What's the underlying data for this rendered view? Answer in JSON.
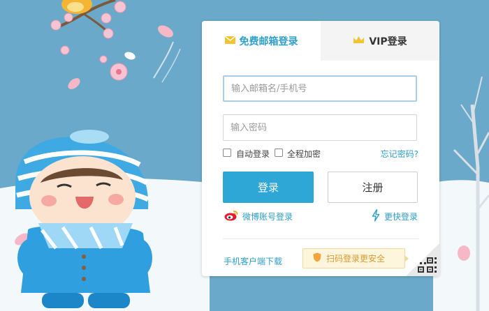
{
  "tabs": {
    "mail_label": "免费邮箱登录",
    "vip_label": "VIP登录",
    "mail_icon": "envelope-icon",
    "vip_icon": "crown-icon"
  },
  "form": {
    "email_placeholder": "输入邮箱名/手机号",
    "email_value": "",
    "password_placeholder": "输入密码",
    "password_value": "",
    "auto_login_label": "自动登录",
    "auto_login_checked": false,
    "full_encrypt_label": "全程加密",
    "full_encrypt_checked": false,
    "forgot_label": "忘记密码?"
  },
  "buttons": {
    "login_label": "登录",
    "register_label": "注册"
  },
  "alt_login": {
    "weibo_label": "微博账号登录",
    "weibo_icon": "weibo-icon",
    "fast_label": "更快登录",
    "fast_icon": "lightning-icon"
  },
  "footer": {
    "app_download_label": "手机客户端下载",
    "qr_tip_label": "扫码登录更安全",
    "qr_tip_icon": "shield-icon",
    "qr_corner_icon": "qr-code-icon"
  },
  "colors": {
    "accent": "#2ea7d6",
    "link": "#2e9fc9",
    "background": "#6aa9c9",
    "tip_bg": "#fdf6dc",
    "tip_text": "#d99a32"
  }
}
